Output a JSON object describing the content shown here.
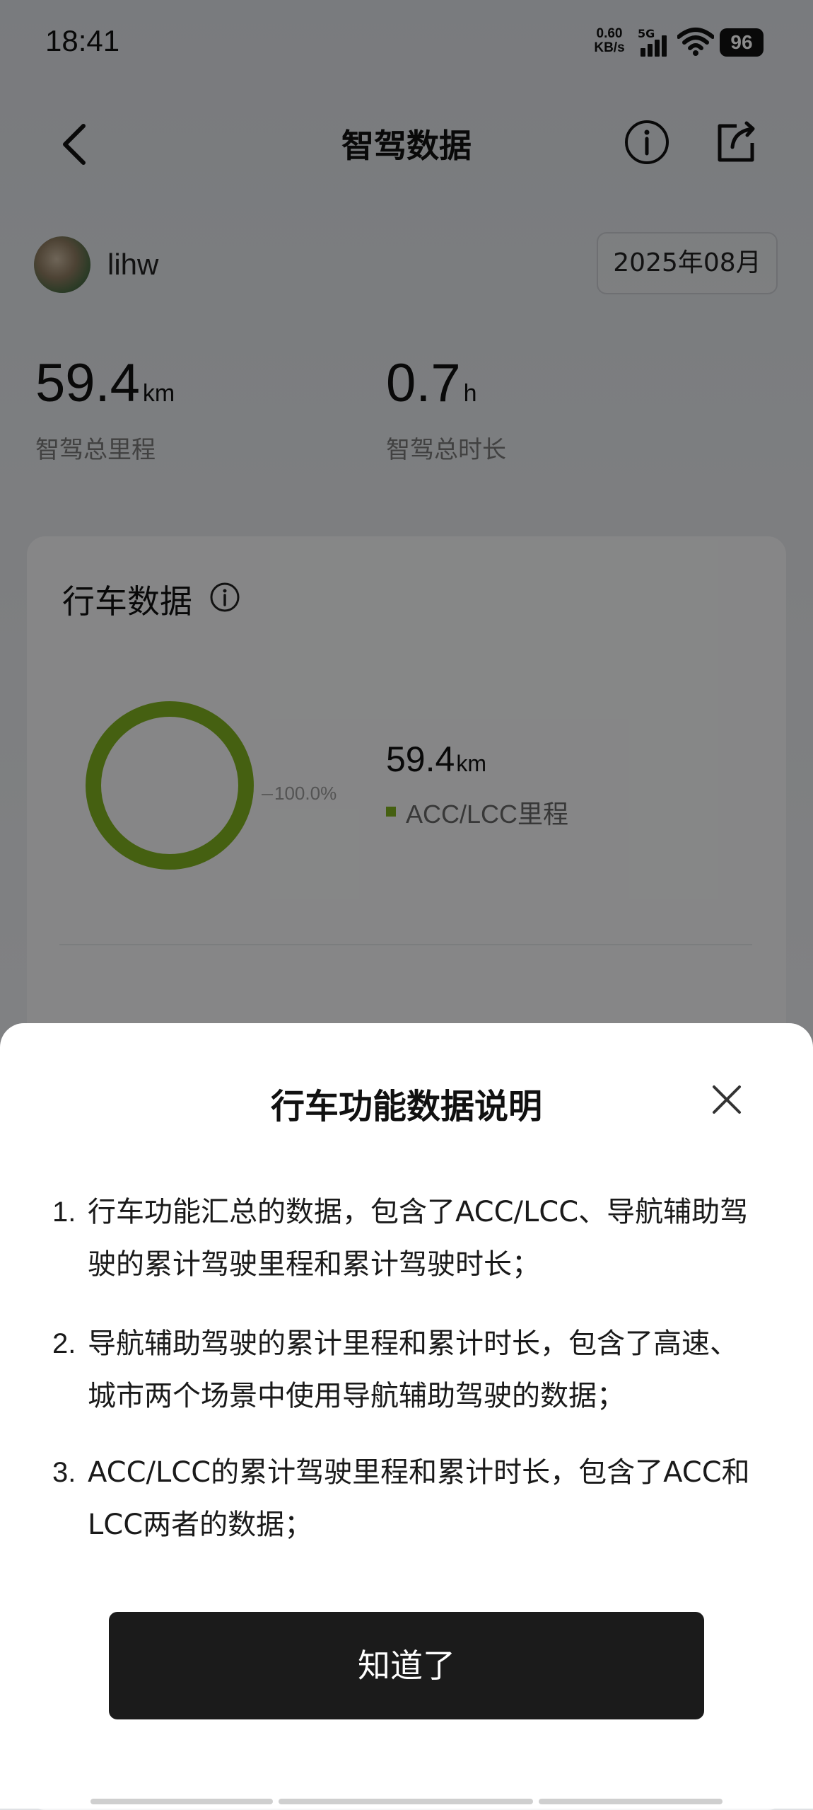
{
  "status_bar": {
    "time": "18:41",
    "net_speed_value": "0.60",
    "net_speed_unit": "KB/s",
    "signal_label": "5G",
    "battery": "96"
  },
  "header": {
    "title": "智驾数据",
    "icons": [
      "back-icon",
      "info-icon",
      "share-icon"
    ]
  },
  "user": {
    "name": "lihw",
    "month": "2025年08月"
  },
  "stats": {
    "distance_value": "59.4",
    "distance_unit": "km",
    "distance_label": "智驾总里程",
    "duration_value": "0.7",
    "duration_unit": "h",
    "duration_label": "智驾总时长"
  },
  "driving_card": {
    "title": "行车数据",
    "chart_data": {
      "type": "pie",
      "categories": [
        "ACC/LCC里程"
      ],
      "values": [
        100.0
      ],
      "data_labels": [
        "100.0%"
      ],
      "colors": [
        "#7fb020"
      ]
    },
    "value": "59.4",
    "unit": "km",
    "legend_label": "ACC/LCC里程"
  },
  "sheet": {
    "title": "行车功能数据说明",
    "items": [
      {
        "num": "1.",
        "text": "行车功能汇总的数据，包含了ACC/LCC、导航辅助驾驶的累计驾驶里程和累计驾驶时长；"
      },
      {
        "num": "2.",
        "text": "导航辅助驾驶的累计里程和累计时长，包含了高速、城市两个场景中使用导航辅助驾驶的数据；"
      },
      {
        "num": "3.",
        "text": "ACC/LCC的累计驾驶里程和累计时长，包含了ACC和LCC两者的数据；"
      }
    ],
    "confirm_label": "知道了"
  },
  "colors": {
    "accent_green": "#7fb020",
    "button_dark": "#1b1b1b",
    "overlay": "rgba(0,0,0,0.45)"
  }
}
